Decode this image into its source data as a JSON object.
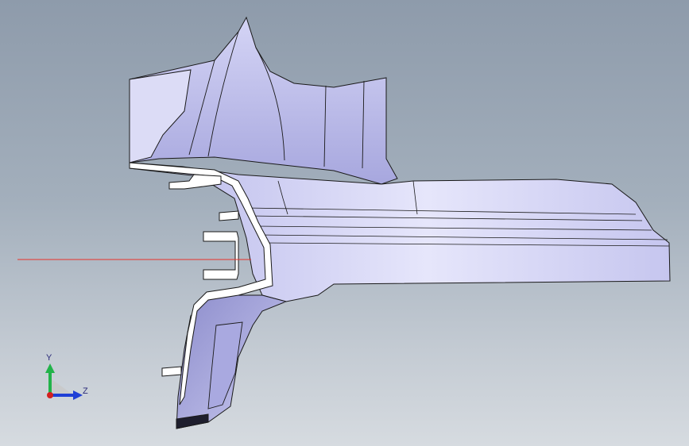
{
  "viewport": {
    "background_top": "#8e9bab",
    "background_bottom": "#d6dbe0"
  },
  "model": {
    "surface_color": "#c8c8ee",
    "surface_shadow": "#9a9ad2",
    "edge_color": "#1a1a1a",
    "section_color": "#ffffff"
  },
  "reference_line": {
    "color": "#e8322c"
  },
  "triad": {
    "y_label": "Y",
    "z_label": "Z",
    "y_color": "#22b34a",
    "z_color": "#1f3fd6",
    "x_color": "#d42020"
  }
}
